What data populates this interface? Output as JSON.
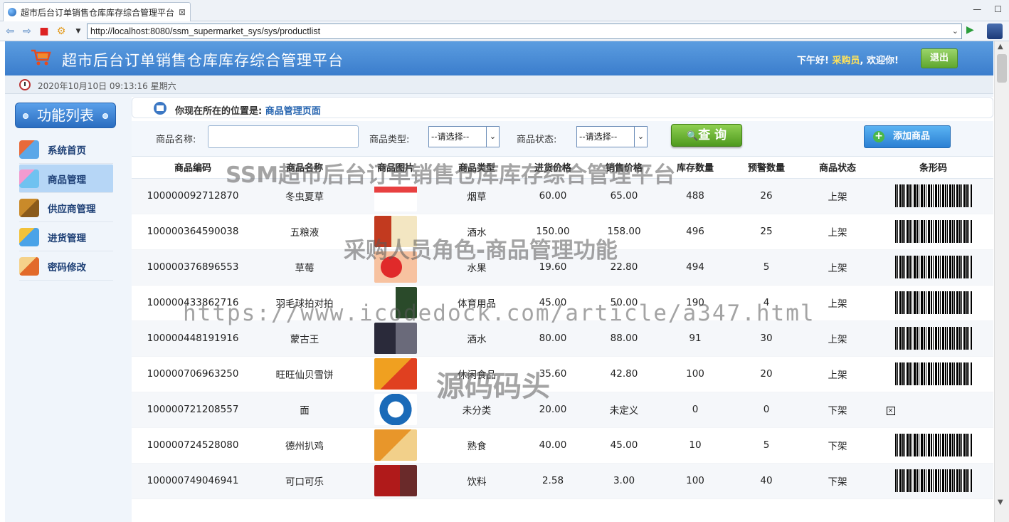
{
  "browser": {
    "tab_title": "超市后台订单销售仓库库存综合管理平台",
    "tab_close": "⊠",
    "url": "http://localhost:8080/ssm_supermarket_sys/sys/productlist"
  },
  "header": {
    "site_title": "超市后台订单销售仓库库存综合管理平台",
    "greeting_prefix": "下午好!",
    "role": "采购员",
    "greeting_suffix": ", 欢迎你!",
    "logout_label": "退出"
  },
  "datebar": {
    "datetime": "2020年10月10日 09:13:16 星期六"
  },
  "sidebar": {
    "title": "功能列表",
    "items": [
      {
        "label": "系统首页",
        "icon": "house-icon"
      },
      {
        "label": "商品管理",
        "icon": "goods-icon"
      },
      {
        "label": "供应商管理",
        "icon": "supplier-icon"
      },
      {
        "label": "进货管理",
        "icon": "purchase-icon"
      },
      {
        "label": "密码修改",
        "icon": "password-icon"
      }
    ]
  },
  "breadcrumb": {
    "prefix": "你现在所在的位置是:",
    "current": "商品管理页面"
  },
  "search": {
    "name_label": "商品名称:",
    "name_value": "",
    "type_label": "商品类型:",
    "type_selected": "--请选择--",
    "status_label": "商品状态:",
    "status_selected": "--请选择--",
    "query_label": "查 询",
    "add_label": "添加商品"
  },
  "table": {
    "headers": [
      "商品编码",
      "商品名称",
      "商品图片",
      "商品类型",
      "进货价格",
      "销售价格",
      "库存数量",
      "预警数量",
      "商品状态",
      "条形码"
    ],
    "rows": [
      {
        "code": "100000092712870",
        "name": "冬虫夏草",
        "type": "烟草",
        "cost": "60.00",
        "price": "65.00",
        "stock": "488",
        "warn": "26",
        "status": "上架",
        "barcode": true
      },
      {
        "code": "100000364590038",
        "name": "五粮液",
        "type": "酒水",
        "cost": "150.00",
        "price": "158.00",
        "stock": "496",
        "warn": "25",
        "status": "上架",
        "barcode": true
      },
      {
        "code": "100000376896553",
        "name": "草莓",
        "type": "水果",
        "cost": "19.60",
        "price": "22.80",
        "stock": "494",
        "warn": "5",
        "status": "上架",
        "barcode": true
      },
      {
        "code": "100000433862716",
        "name": "羽毛球拍对拍",
        "type": "体育用品",
        "cost": "45.00",
        "price": "50.00",
        "stock": "190",
        "warn": "4",
        "status": "上架",
        "barcode": true
      },
      {
        "code": "100000448191916",
        "name": "蒙古王",
        "type": "酒水",
        "cost": "80.00",
        "price": "88.00",
        "stock": "91",
        "warn": "30",
        "status": "上架",
        "barcode": true
      },
      {
        "code": "100000706963250",
        "name": "旺旺仙贝雪饼",
        "type": "休闲食品",
        "cost": "35.60",
        "price": "42.80",
        "stock": "100",
        "warn": "20",
        "status": "上架",
        "barcode": true
      },
      {
        "code": "100000721208557",
        "name": "面",
        "type": "未分类",
        "cost": "20.00",
        "price": "未定义",
        "stock": "0",
        "warn": "0",
        "status": "下架",
        "barcode": false
      },
      {
        "code": "100000724528080",
        "name": "德州扒鸡",
        "type": "熟食",
        "cost": "40.00",
        "price": "45.00",
        "stock": "10",
        "warn": "5",
        "status": "下架",
        "barcode": true
      },
      {
        "code": "100000749046941",
        "name": "可口可乐",
        "type": "饮料",
        "cost": "2.58",
        "price": "3.00",
        "stock": "100",
        "warn": "40",
        "status": "下架",
        "barcode": true
      }
    ]
  },
  "watermark": {
    "line1": "SSM超市后台订单销售仓库库存综合管理平台",
    "line2": "采购人员角色-商品管理功能",
    "line3": "https://www.icodedock.com/article/a347.html",
    "line4": "源码码头"
  },
  "colors": {
    "header_blue": "#3b7dcc",
    "accent_green": "#5fa72e",
    "role_yellow": "#ffe35a",
    "breadcrumb_blue": "#2765b0"
  }
}
